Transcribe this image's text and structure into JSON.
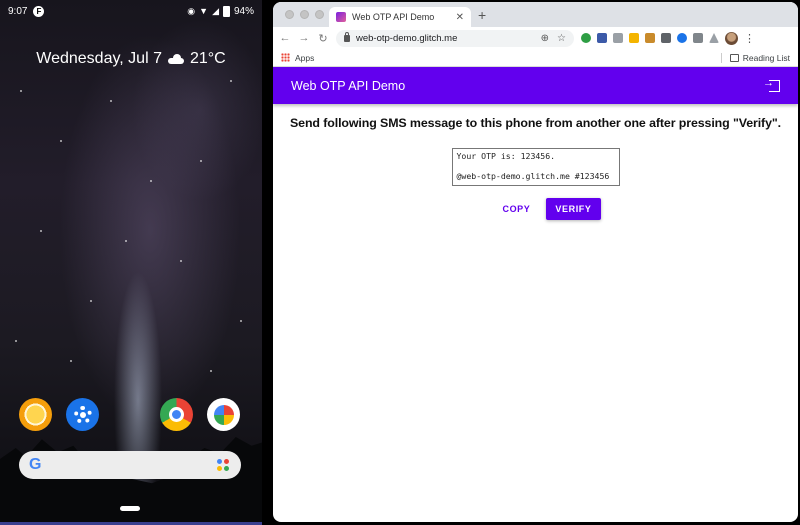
{
  "phone": {
    "status_time": "9:07",
    "status_app_letter": "F",
    "battery": "94%",
    "date": "Wednesday, Jul 7",
    "temperature": "21°C",
    "weather_icon": "cloud-icon",
    "dock_apps": [
      "clock-icon",
      "settings-icon",
      "chrome-icon",
      "photos-icon"
    ],
    "search_logo": "G"
  },
  "browser": {
    "tab_title": "Web OTP API Demo",
    "tab_close": "✕",
    "new_tab": "+",
    "url": "web-otp-demo.glitch.me",
    "bookmarks": {
      "apps_label": "Apps",
      "reading_list_label": "Reading List"
    }
  },
  "page": {
    "app_title": "Web OTP API Demo",
    "instruction": "Send following SMS message to this phone from another one after pressing \"Verify\".",
    "sms_message": "Your OTP is: 123456.\n\n@web-otp-demo.glitch.me #123456",
    "copy_label": "COPY",
    "verify_label": "VERIFY"
  },
  "colors": {
    "primary": "#6200ee",
    "titlebar": "#dee1e6"
  }
}
